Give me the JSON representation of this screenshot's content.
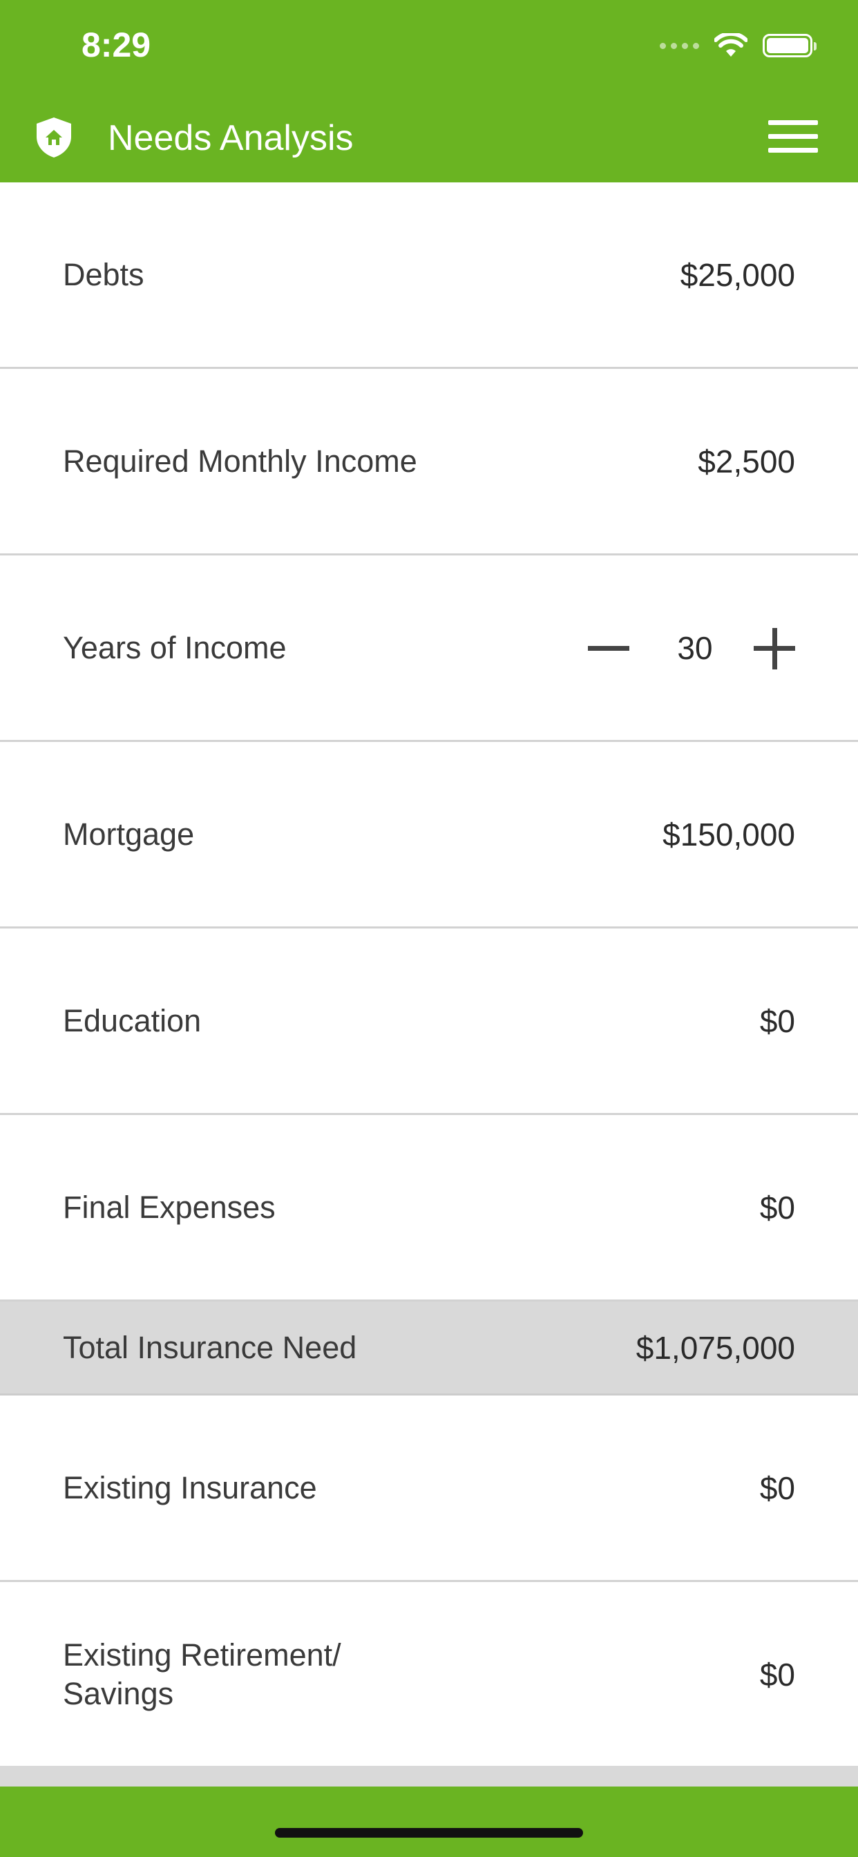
{
  "status_bar": {
    "time": "8:29"
  },
  "header": {
    "title": "Needs Analysis"
  },
  "rows": [
    {
      "label": "Debts",
      "value": "$25,000"
    },
    {
      "label": "Required Monthly Income",
      "value": "$2,500"
    },
    {
      "label": "Years of Income",
      "stepper_value": "30"
    },
    {
      "label": "Mortgage",
      "value": "$150,000"
    },
    {
      "label": "Education",
      "value": "$0"
    },
    {
      "label": "Final Expenses",
      "value": "$0"
    },
    {
      "label": "Total Insurance Need",
      "value": "$1,075,000"
    },
    {
      "label": "Existing Insurance",
      "value": "$0"
    },
    {
      "label": "Existing Retirement/ Savings",
      "value": "$0"
    }
  ],
  "colors": {
    "brand_green": "#6ab422",
    "total_row_bg": "#d9d9d9"
  },
  "icons": {
    "logo": "shield-house-icon",
    "menu": "hamburger-menu-icon"
  }
}
